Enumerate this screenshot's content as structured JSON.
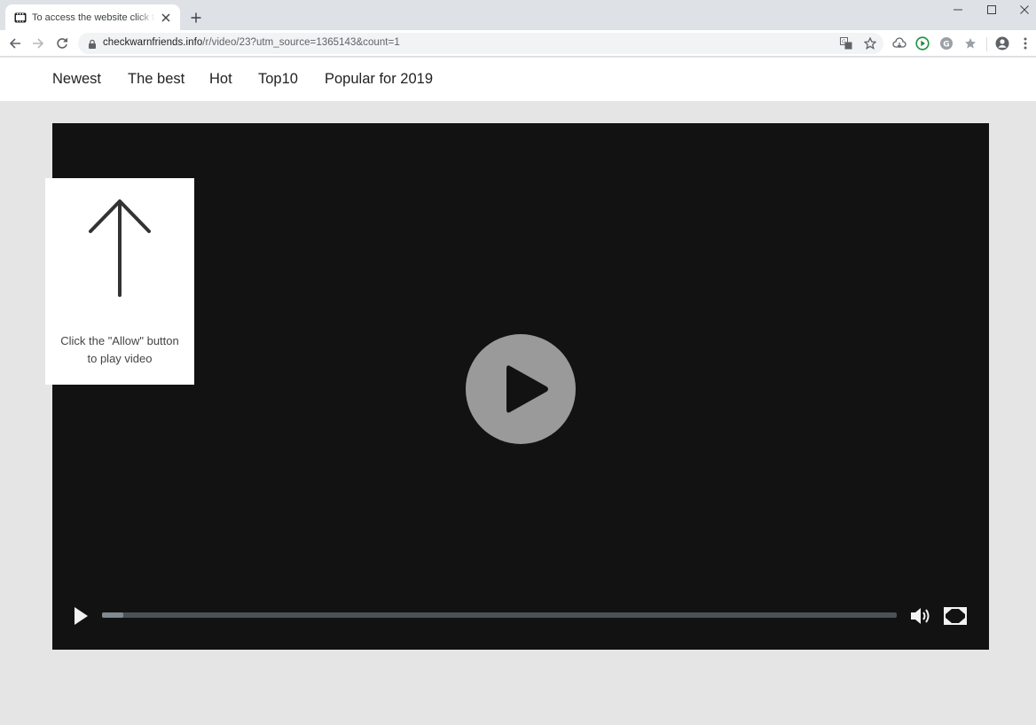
{
  "browser": {
    "tab_title": "To access the website click the \"Allow\" button",
    "url_host": "checkwarnfriends.info",
    "url_path": "/r/video/23?utm_source=1365143&count=1",
    "icons": [
      "video-favicon-icon",
      "close-icon",
      "plus-icon",
      "minimize-icon",
      "maximize-icon",
      "window-close-icon",
      "back-icon",
      "forward-icon",
      "reload-icon",
      "lock-icon",
      "translate-icon",
      "bookmark-star-icon",
      "cloud-icon",
      "play-extension-icon",
      "grammarly-icon",
      "star-extension-icon",
      "profile-icon",
      "kebab-menu-icon"
    ]
  },
  "nav": {
    "items": [
      "Newest",
      "The best",
      "Hot",
      "Top10",
      "Popular for 2019"
    ]
  },
  "player": {
    "progress_fraction": 0.027,
    "colors": {
      "background": "#121212",
      "big_play": "#9a9a9a",
      "track": "#4b5257",
      "fill": "#7f8a91"
    }
  },
  "prompt": {
    "line1": "Click the \"Allow\" button",
    "line2": "to play video"
  }
}
